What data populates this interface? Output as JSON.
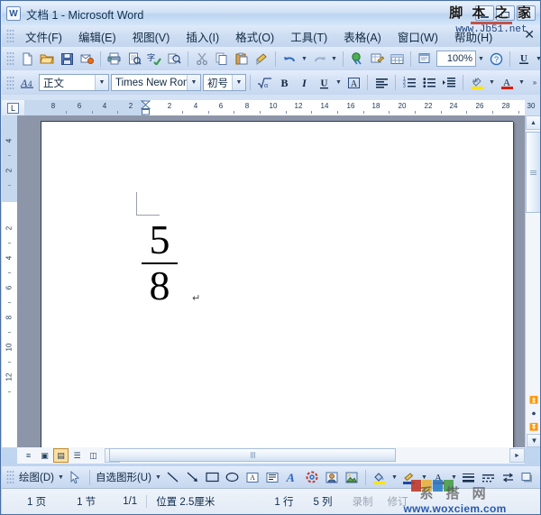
{
  "window": {
    "title": "文档 1 - Microsoft Word",
    "app_icon": "word-document-icon",
    "minimize_label": "最小化",
    "restore_label": "还原",
    "close_label": "关闭"
  },
  "menubar": {
    "items": [
      {
        "label": "文件(F)",
        "name": "menu-file"
      },
      {
        "label": "编辑(E)",
        "name": "menu-edit"
      },
      {
        "label": "视图(V)",
        "name": "menu-view"
      },
      {
        "label": "插入(I)",
        "name": "menu-insert"
      },
      {
        "label": "格式(O)",
        "name": "menu-format"
      },
      {
        "label": "工具(T)",
        "name": "menu-tools"
      },
      {
        "label": "表格(A)",
        "name": "menu-table"
      },
      {
        "label": "窗口(W)",
        "name": "menu-window"
      },
      {
        "label": "帮助(H)",
        "name": "menu-help"
      }
    ],
    "close_doc": "✕"
  },
  "standard_toolbar": {
    "zoom_value": "100%",
    "overflow": "»",
    "buttons": [
      "new-document-icon",
      "open-folder-icon",
      "save-disk-icon",
      "email-icon",
      "print-icon",
      "print-preview-icon",
      "spellcheck-icon",
      "research-icon",
      "cut-scissors-icon",
      "copy-icon",
      "paste-icon",
      "format-painter-icon",
      "undo-icon",
      "redo-icon",
      "insert-hyperlink-icon",
      "tables-borders-icon",
      "insert-table-icon",
      "columns-icon",
      "zoom-icon",
      "help-icon",
      "underline-icon"
    ]
  },
  "formatting_toolbar": {
    "style": "正文",
    "font": "Times New Roma",
    "size": "初号",
    "overflow": "»",
    "buttons": [
      "styles-formatting-icon",
      "equation-icon",
      "bold-icon",
      "italic-icon",
      "underline-icon",
      "character-border-icon",
      "align-left-icon",
      "numbered-list-icon",
      "bulleted-list-icon",
      "increase-indent-icon",
      "highlight-icon",
      "font-color-icon"
    ]
  },
  "ruler": {
    "tab_stop_marker": "L",
    "horizontal_labels": [
      "8",
      "6",
      "4",
      "2",
      "2",
      "4",
      "6",
      "8",
      "10",
      "12",
      "14",
      "16",
      "18",
      "20",
      "22",
      "24",
      "26",
      "28",
      "30"
    ],
    "vertical_labels": [
      "4",
      "2",
      "2",
      "4",
      "6",
      "8",
      "10",
      "12"
    ]
  },
  "document": {
    "fraction_numerator": "5",
    "fraction_denominator": "8",
    "paragraph_mark": "↵"
  },
  "view_buttons": [
    {
      "name": "view-normal",
      "glyph": "≡",
      "selected": false
    },
    {
      "name": "view-web-layout",
      "glyph": "▣",
      "selected": false
    },
    {
      "name": "view-print-layout",
      "glyph": "▤",
      "selected": true
    },
    {
      "name": "view-outline",
      "glyph": "☰",
      "selected": false
    },
    {
      "name": "view-reading-layout",
      "glyph": "◫",
      "selected": false
    }
  ],
  "drawing_toolbar": {
    "draw_label": "绘图(D)",
    "autoshapes_label": "自选图形(U)",
    "overflow": "»",
    "buttons": [
      "select-objects-icon",
      "line-icon",
      "arrow-icon",
      "rectangle-icon",
      "oval-icon",
      "text-box-icon",
      "vertical-text-box-icon",
      "wordart-icon",
      "diagram-icon",
      "clip-art-icon",
      "insert-picture-icon",
      "fill-color-icon",
      "line-color-icon",
      "font-color-icon",
      "line-style-icon",
      "dash-style-icon",
      "arrow-style-icon",
      "shadow-icon",
      "3d-icon"
    ]
  },
  "statusbar": {
    "page": "1 页",
    "section": "1 节",
    "page_of": "1/1",
    "position": "位置 2.5厘米",
    "line": "1 行",
    "column": "5 列",
    "rec": "录制",
    "trk": "修订"
  },
  "watermarks": {
    "top_cn": "脚 本 之 家",
    "top_url": "www.Jb51.net",
    "bottom_cn": "系 搭 网",
    "bottom_url": "www.woxciem.com"
  },
  "colors": {
    "chrome": "#cadcf2",
    "doc_background": "#8d96a9",
    "page": "#ffffff",
    "accent": "#2b5797",
    "selected_view": "#fcdfa0"
  }
}
